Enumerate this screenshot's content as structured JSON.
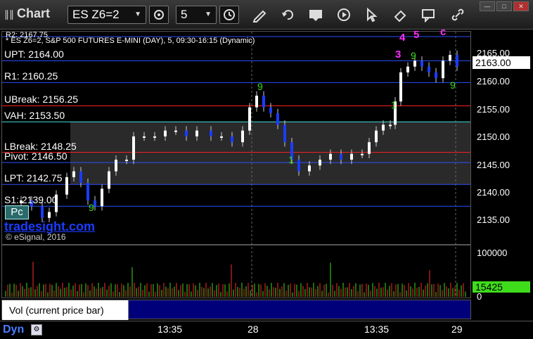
{
  "toolbar": {
    "title": "Chart",
    "symbol": "ES Z6=2",
    "interval": "5",
    "window_buttons": [
      "—",
      "□",
      "✕"
    ]
  },
  "chart": {
    "partial_label": "R2: 2167.75",
    "subtitle": "* ES Z6=2, S&P 500 FUTURES E-MINI (DAY), 5, 09:30-16:15 (Dynamic)",
    "current_price": "2163.00",
    "brand": "tradesight.com",
    "copyright": "© eSignal, 2016",
    "pc_button": "Pc"
  },
  "levels": [
    {
      "label": "UPT: 2164.00",
      "price": 2164.0,
      "color": "#2a50ff"
    },
    {
      "label": "R1: 2160.25",
      "price": 2160.25,
      "color": "#2a50ff"
    },
    {
      "label": "UBreak: 2156.25",
      "price": 2156.25,
      "color": "#ff2020"
    },
    {
      "label": "VAH: 2153.50",
      "price": 2153.5,
      "color": "#40e0e0"
    },
    {
      "label": "LBreak: 2148.25",
      "price": 2148.25,
      "color": "#ff2020"
    },
    {
      "label": "Pivot: 2146.50",
      "price": 2146.5,
      "color": "#2a50ff"
    },
    {
      "label": "LPT: 2142.75",
      "price": 2142.75,
      "color": "#2a50ff"
    },
    {
      "label": "S1: 2139.00",
      "price": 2139.0,
      "color": "#2a50ff"
    }
  ],
  "chart_data": {
    "type": "candlestick",
    "price_ticks": [
      "2165.00",
      "2160.00",
      "2155.00",
      "2150.00",
      "2145.00",
      "2140.00",
      "2135.00"
    ],
    "price_range": [
      2132.5,
      2169.0
    ],
    "volume_ticks": [
      "100000",
      "0"
    ],
    "current_volume": "15425",
    "time_labels": [
      "13:35",
      "28",
      "13:35",
      "29"
    ],
    "colors": {
      "up": "#ffffff",
      "down": "#1a3cff",
      "vol": [
        "#ff2a2a",
        "#3fdc1c"
      ]
    }
  },
  "sequence_labels": {
    "magenta": [
      "4",
      "5",
      "c",
      "3"
    ],
    "green_sample": [
      "9",
      "1",
      "9",
      "9",
      "9",
      "1"
    ]
  },
  "volume_legend": {
    "label": "Vol (current price bar)",
    "close": "×"
  },
  "bottom": {
    "dyn": "Dyn"
  }
}
